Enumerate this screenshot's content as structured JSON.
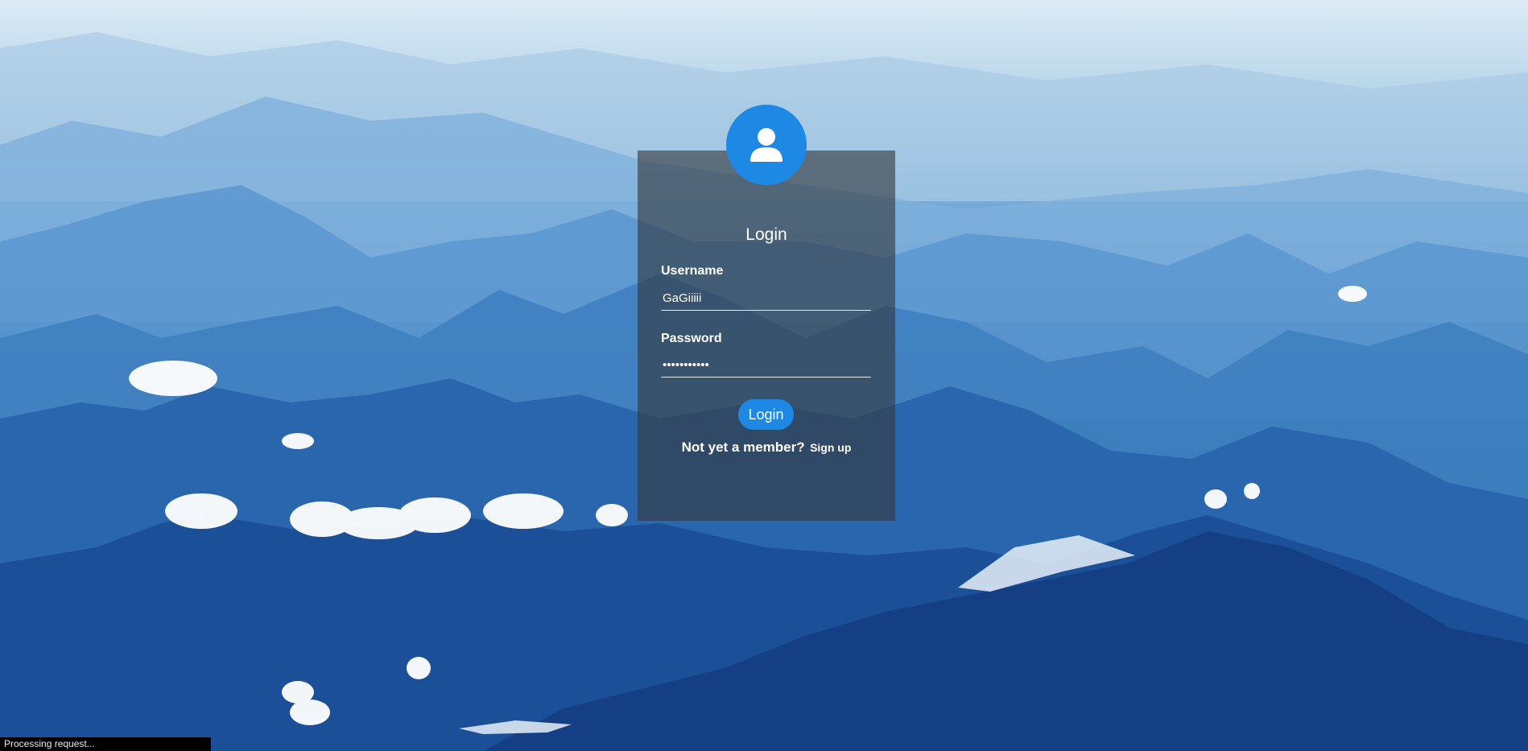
{
  "login": {
    "title": "Login",
    "username_label": "Username",
    "username_value": "GaGiiiii",
    "password_label": "Password",
    "password_value": "•••••••••••",
    "login_button": "Login",
    "member_prompt": "Not yet a member?",
    "signup_link": "Sign up"
  },
  "status_bar": {
    "text": "Processing request..."
  },
  "colors": {
    "accent": "#1e88e5",
    "card_bg": "rgba(50,55,60,0.62)"
  },
  "icons": {
    "avatar": "user-icon"
  }
}
